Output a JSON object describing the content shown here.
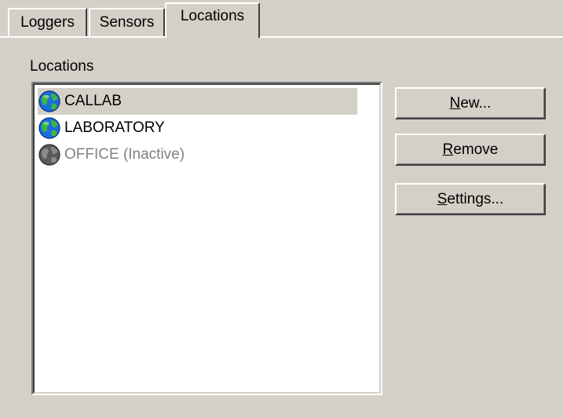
{
  "tabs": [
    {
      "label": "Loggers"
    },
    {
      "label": "Sensors"
    },
    {
      "label": "Locations",
      "active": true
    }
  ],
  "locations_panel": {
    "label": "Locations",
    "items": [
      {
        "name": "CALLAB",
        "icon": "globe-icon",
        "selected": true,
        "active": true
      },
      {
        "name": "LABORATORY",
        "icon": "globe-icon",
        "selected": false,
        "active": true
      },
      {
        "name": "OFFICE (Inactive)",
        "icon": "globe-inactive-icon",
        "selected": false,
        "active": false
      }
    ]
  },
  "buttons": {
    "new": {
      "mnemonic": "N",
      "rest": "ew..."
    },
    "remove": {
      "mnemonic": "R",
      "rest": "emove"
    },
    "settings": {
      "mnemonic": "S",
      "rest": "ettings..."
    }
  },
  "colors": {
    "face": "#d4d0c8",
    "highlight": "#ffffff",
    "shadow": "#808080",
    "dark_shadow": "#404040",
    "inactive_text": "#808080"
  }
}
